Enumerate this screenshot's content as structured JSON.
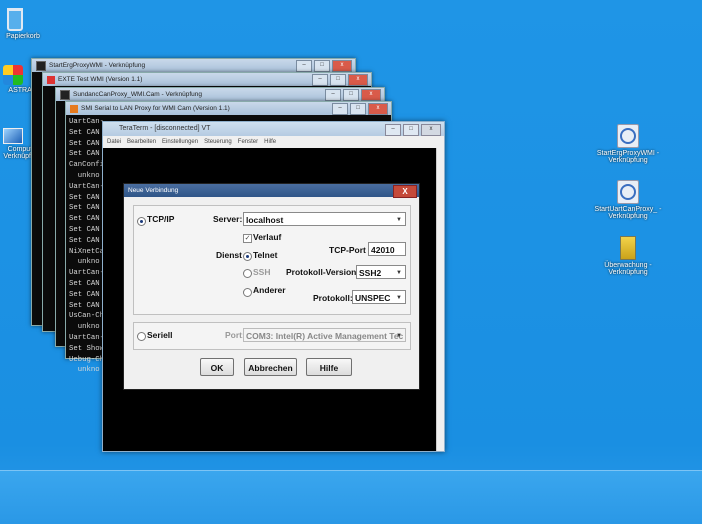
{
  "desktop": {
    "icons": [
      {
        "name": "recycle-bin-icon",
        "label": "Papierkorb"
      },
      {
        "name": "app-icon-2",
        "label": "ASTRA.e"
      },
      {
        "name": "computer-icon",
        "label": "Computer Verknüpfung"
      },
      {
        "name": "shortcut-icon-1",
        "label": "StartErgProxyWMI - Verknüpfung"
      },
      {
        "name": "shortcut-icon-2",
        "label": "StartUartCanProxy_ - Verknüpfung"
      },
      {
        "name": "shortcut-icon-3",
        "label": "Überwachung - Verknüpfung"
      }
    ]
  },
  "windows": [
    {
      "title": "StartErgProxyWMI - Verknüpfung"
    },
    {
      "title": "EXTE Test WMI (Version 1.1)"
    },
    {
      "title": "SundancCanProxy_WMI.Cam - Verknüpfung"
    },
    {
      "title": "SMI Serial to LAN Proxy for WMI Cam (Version 1.1)"
    }
  ],
  "console_lines": [
    "UartCan-",
    "Set CAN",
    "Set CAN",
    "Set CAN",
    "CanConfi",
    "  unkno",
    "UartCan-",
    "Set CAN",
    "Set CAN",
    "Set CAN",
    "Set CAN",
    "Set CAN",
    "NiXnetCa",
    "  unkno",
    "UartCan-",
    "Set CAN",
    "Set CAN",
    "Set CAN",
    "UsCan-Ch",
    "  unkno",
    "UartCan-",
    "Set Show",
    "Uebug-Ch",
    "  unkno"
  ],
  "putty": {
    "title": "TeraTerm - [disconnected] VT",
    "menu": [
      "Datei",
      "Bearbeiten",
      "Einstellungen",
      "Steuerung",
      "Fenster",
      "Hilfe"
    ]
  },
  "dialog": {
    "title": "Neue Verbindung",
    "close": "X",
    "tcpip_label": "TCP/IP",
    "server_label": "Server:",
    "server_value": "localhost",
    "verlauf_label": "Verlauf",
    "tcp_port_label": "TCP-Port",
    "tcp_port_value": "42010",
    "dienst_label": "Dienst",
    "telnet_label": "Telnet",
    "ssh_label": "SSH",
    "protokoll_version_label": "Protokoll-Version",
    "protokoll_version_value": "SSH2",
    "anderer_label": "Anderer",
    "protokoll_label": "Protokoll:",
    "protokoll_value": "UNSPEC",
    "seriell_label": "Seriell",
    "port_label": "Port:",
    "port_value": "COM3: Intel(R) Active Management Tec",
    "ok": "OK",
    "cancel": "Abbrechen",
    "help": "Hilfe"
  }
}
